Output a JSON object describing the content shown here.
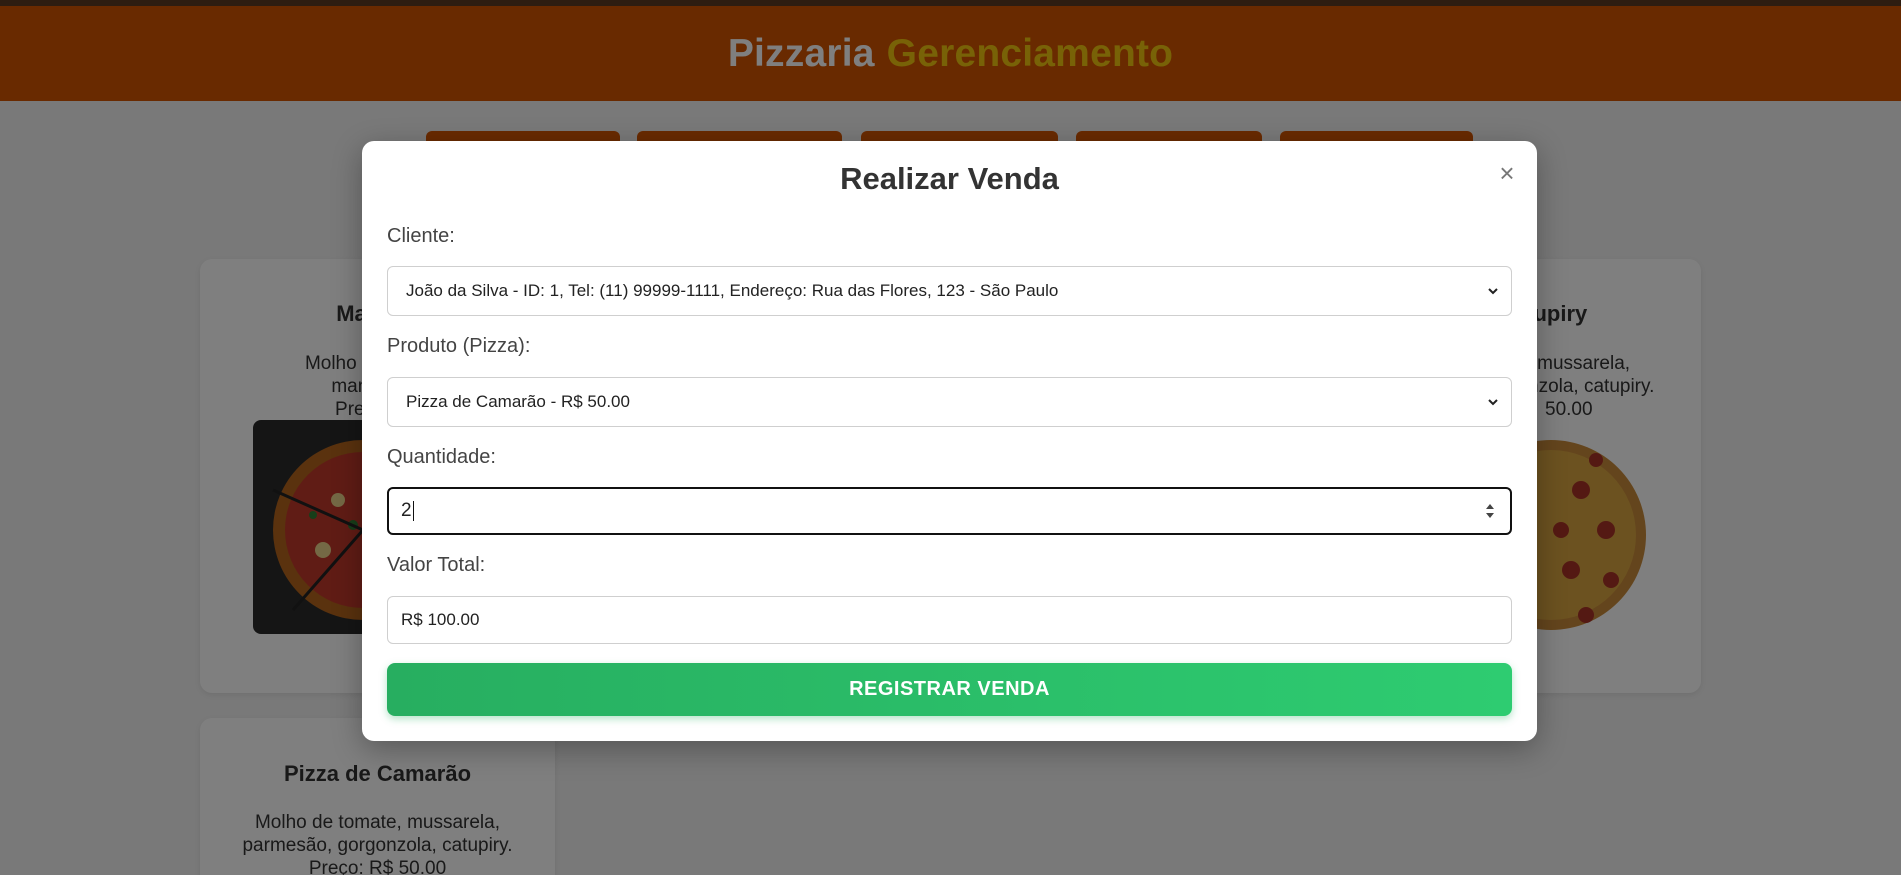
{
  "header": {
    "title_part1": "Pizzaria",
    "title_part2": "Gerenciamento"
  },
  "cards": [
    {
      "title": "Marg",
      "desc_line1": "Molho de tom",
      "desc_line2": "manjeri",
      "price": "Preço:"
    },
    {
      "title": "Catupiry",
      "desc_line1": "e, mussarela,",
      "desc_line2": "nzola, catupiry.",
      "price": "50.00"
    },
    {
      "title": "Pizza de Camarão",
      "desc_line1": "Molho de tomate, mussarela,",
      "desc_line2": "parmesão, gorgonzola, catupiry.",
      "price": "Preço: R$ 50.00"
    }
  ],
  "modal": {
    "title": "Realizar Venda",
    "close_symbol": "×",
    "cliente_label": "Cliente:",
    "cliente_value": "João da Silva - ID: 1, Tel: (11) 99999-1111, Endereço: Rua das Flores, 123 - São Paulo",
    "produto_label": "Produto (Pizza):",
    "produto_value": "Pizza de Camarão - R$ 50.00",
    "quantidade_label": "Quantidade:",
    "quantidade_value": "2",
    "total_label": "Valor Total:",
    "total_value": "R$ 100.00",
    "submit_label": "REGISTRAR VENDA"
  },
  "colors": {
    "header": "#d35400",
    "accent": "#f1c40f",
    "submit": "#2ecc71"
  }
}
